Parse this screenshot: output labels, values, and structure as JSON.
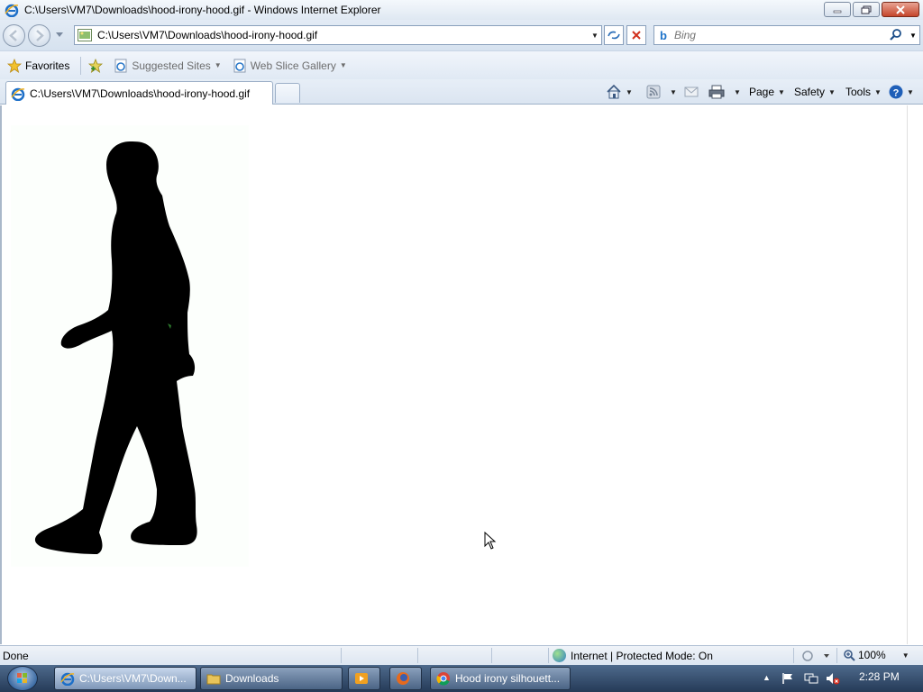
{
  "window": {
    "title": "C:\\Users\\VM7\\Downloads\\hood-irony-hood.gif - Windows Internet Explorer"
  },
  "addressbar": {
    "url": "C:\\Users\\VM7\\Downloads\\hood-irony-hood.gif",
    "search_placeholder": "Bing"
  },
  "favorites": {
    "favorites_label": "Favorites",
    "suggested_label": "Suggested Sites",
    "webslice_label": "Web Slice Gallery"
  },
  "tabs": [
    {
      "label": "C:\\Users\\VM7\\Downloads\\hood-irony-hood.gif"
    }
  ],
  "commandbar": {
    "page_label": "Page",
    "safety_label": "Safety",
    "tools_label": "Tools"
  },
  "statusbar": {
    "status": "Done",
    "zone": "Internet | Protected Mode: On",
    "zoom": "100%"
  },
  "taskbar": {
    "items": [
      {
        "label": "C:\\Users\\VM7\\Down..."
      },
      {
        "label": "Downloads"
      },
      {
        "label": "Hood irony silhouett..."
      }
    ],
    "clock": "2:28 PM"
  },
  "colors": {
    "accent": "#1e73c9",
    "silhouette": "#000000"
  }
}
